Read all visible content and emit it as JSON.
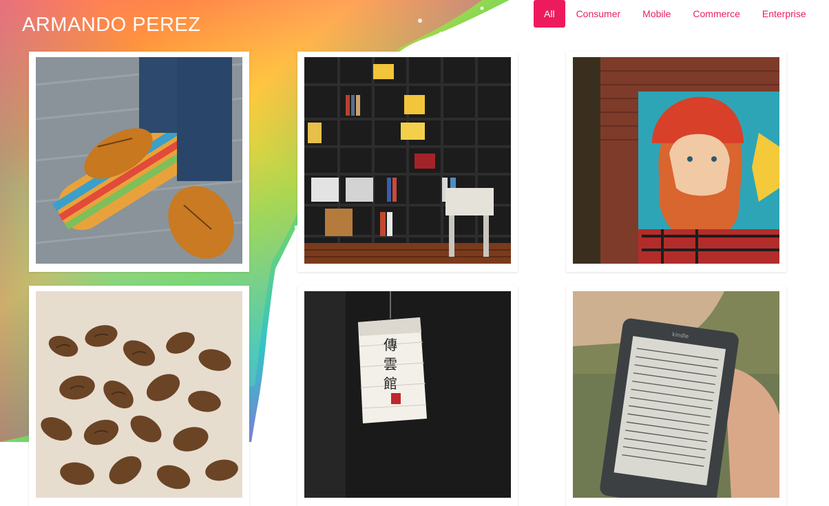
{
  "brand": {
    "name": "ARMANDO PEREZ"
  },
  "nav": {
    "items": [
      {
        "label": "All",
        "active": true
      },
      {
        "label": "Consumer",
        "active": false
      },
      {
        "label": "Mobile",
        "active": false
      },
      {
        "label": "Commerce",
        "active": false
      },
      {
        "label": "Enterprise",
        "active": false
      }
    ]
  },
  "gallery": {
    "items": [
      {
        "subject": "skateboard-shoes"
      },
      {
        "subject": "bookshelf"
      },
      {
        "subject": "mural-bearded-man"
      },
      {
        "subject": "coffee-beans"
      },
      {
        "subject": "paper-lantern"
      },
      {
        "subject": "e-reader"
      }
    ]
  },
  "photo_text": {
    "lantern_chars": [
      "傳",
      "雲",
      "館"
    ],
    "kindle_brand": "kindle"
  },
  "colors": {
    "accent": "#e91e63",
    "accent_active": "#ed1b5d"
  }
}
